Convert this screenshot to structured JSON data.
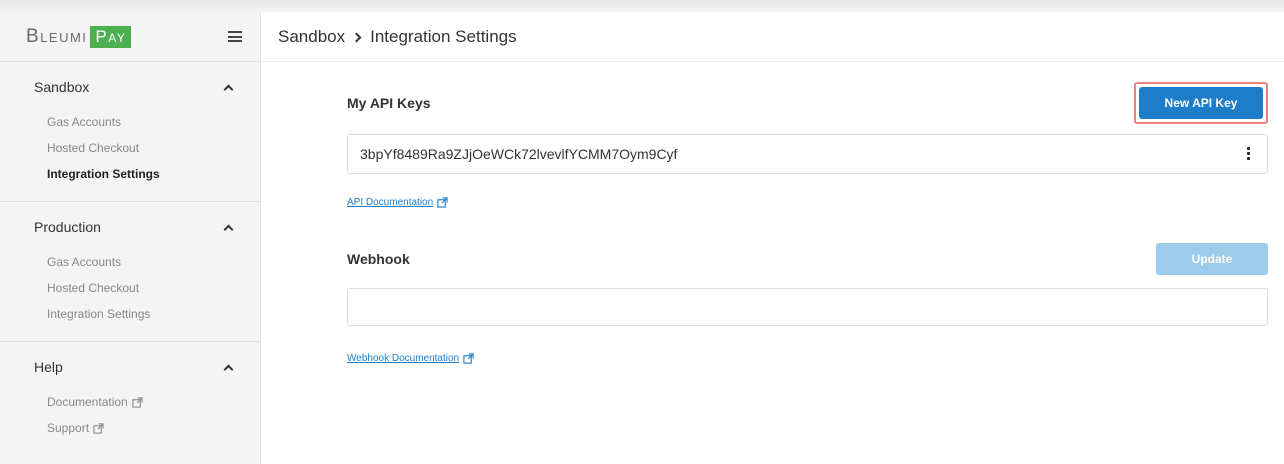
{
  "brand": {
    "name_part1": "Bleumi",
    "name_part2": "Pay",
    "accent": "#4caf50"
  },
  "sidebar": {
    "menu_icon": "hamburger-icon",
    "sections": [
      {
        "title": "Sandbox",
        "items": [
          {
            "label": "Gas Accounts"
          },
          {
            "label": "Hosted Checkout"
          },
          {
            "label": "Integration Settings",
            "active": true
          }
        ]
      },
      {
        "title": "Production",
        "items": [
          {
            "label": "Gas Accounts"
          },
          {
            "label": "Hosted Checkout"
          },
          {
            "label": "Integration Settings"
          }
        ]
      },
      {
        "title": "Help",
        "items": [
          {
            "label": "Documentation",
            "external": true
          },
          {
            "label": "Support",
            "external": true
          }
        ]
      }
    ]
  },
  "header": {
    "breadcrumb": [
      "Sandbox",
      "Integration Settings"
    ]
  },
  "api_keys": {
    "title": "My API Keys",
    "new_button": "New API Key",
    "key_value": "3bpYf8489Ra9ZJjOeWCk72lvevlfYCMM7Oym9Cyf",
    "doc_link": "API Documentation"
  },
  "webhook": {
    "title": "Webhook",
    "update_button": "Update",
    "value": "",
    "placeholder": "",
    "doc_link": "Webhook Documentation"
  },
  "colors": {
    "primary": "#1e7dc9",
    "disabled": "#9dcbea",
    "highlight_border": "#f08080"
  }
}
